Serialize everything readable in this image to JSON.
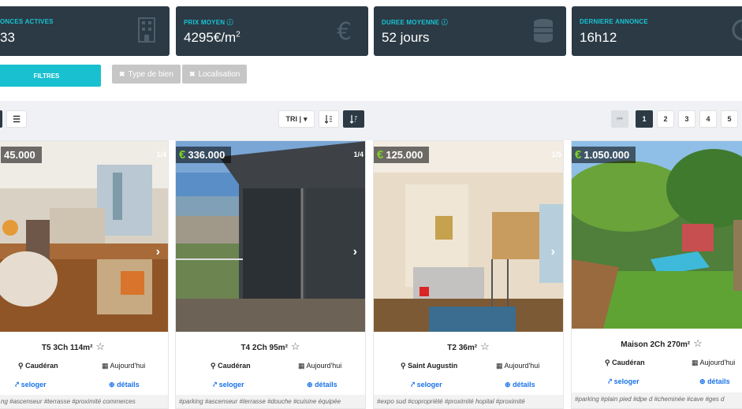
{
  "stats": [
    {
      "label": "ONCES ACTIVES",
      "value": "33",
      "icon": "building-icon"
    },
    {
      "label": "PRIX MOYEN ⓘ",
      "value": "4295€/m",
      "sup": "2",
      "icon": "euro-icon"
    },
    {
      "label": "DUREE MOYENNE ⓘ",
      "value": "52 jours",
      "icon": "coins-icon"
    },
    {
      "label": "DERNIERE ANNONCE",
      "value": "16h12",
      "icon": "clock-icon"
    }
  ],
  "filters": {
    "button": "FILTRES",
    "chips": [
      "Type de bien",
      "Localisation"
    ]
  },
  "toolbar": {
    "sort_label": "TRI |",
    "sort_caret": "▾",
    "sort_asc": "↧",
    "sort_desc": "↧",
    "list_icon": "☰"
  },
  "pagination": {
    "first": "⏮",
    "pages": [
      "1",
      "2",
      "3",
      "4",
      "5"
    ],
    "active": "1"
  },
  "listings": [
    {
      "price": "45.000",
      "show_euro": false,
      "count": "1/4",
      "title": "T5 3Ch 114m²",
      "location": "Caudéran",
      "date": "Aujourd'hui",
      "source": "seloger",
      "details": "détails",
      "tags": "ng #ascenseur #terrasse #proximité commerces"
    },
    {
      "price": "336.000",
      "show_euro": true,
      "count": "1/4",
      "title": "T4 2Ch 95m²",
      "location": "Caudéran",
      "date": "Aujourd'hui",
      "source": "seloger",
      "details": "détails",
      "tags": "#parking #ascenseur #terrasse #douche #cuisine équipée"
    },
    {
      "price": "125.000",
      "show_euro": true,
      "count": "1/5",
      "title": "T2 36m²",
      "location": "Saint Augustin",
      "date": "Aujourd'hui",
      "source": "seloger",
      "details": "détails",
      "tags": "#expo sud #copropriété #proximité hopital #proximité"
    },
    {
      "price": "1.050.000",
      "show_euro": true,
      "count": "",
      "title": "Maison 2Ch 270m²",
      "location": "Caudéran",
      "date": "Aujourd'hui",
      "source": "seloger",
      "details": "détails",
      "tags": "#parking #plain pied #dpe d #cheminée #cave #ges d"
    }
  ],
  "icons": {
    "star": "☆",
    "pin": "⚲",
    "calendar": "▦",
    "link": "↗",
    "plus": "⊕",
    "next": "›",
    "x": "✖"
  },
  "colors": {
    "accent": "#19c0cf",
    "panel": "#2b3a45",
    "link": "#1a73e8",
    "euro": "#7fd321"
  }
}
